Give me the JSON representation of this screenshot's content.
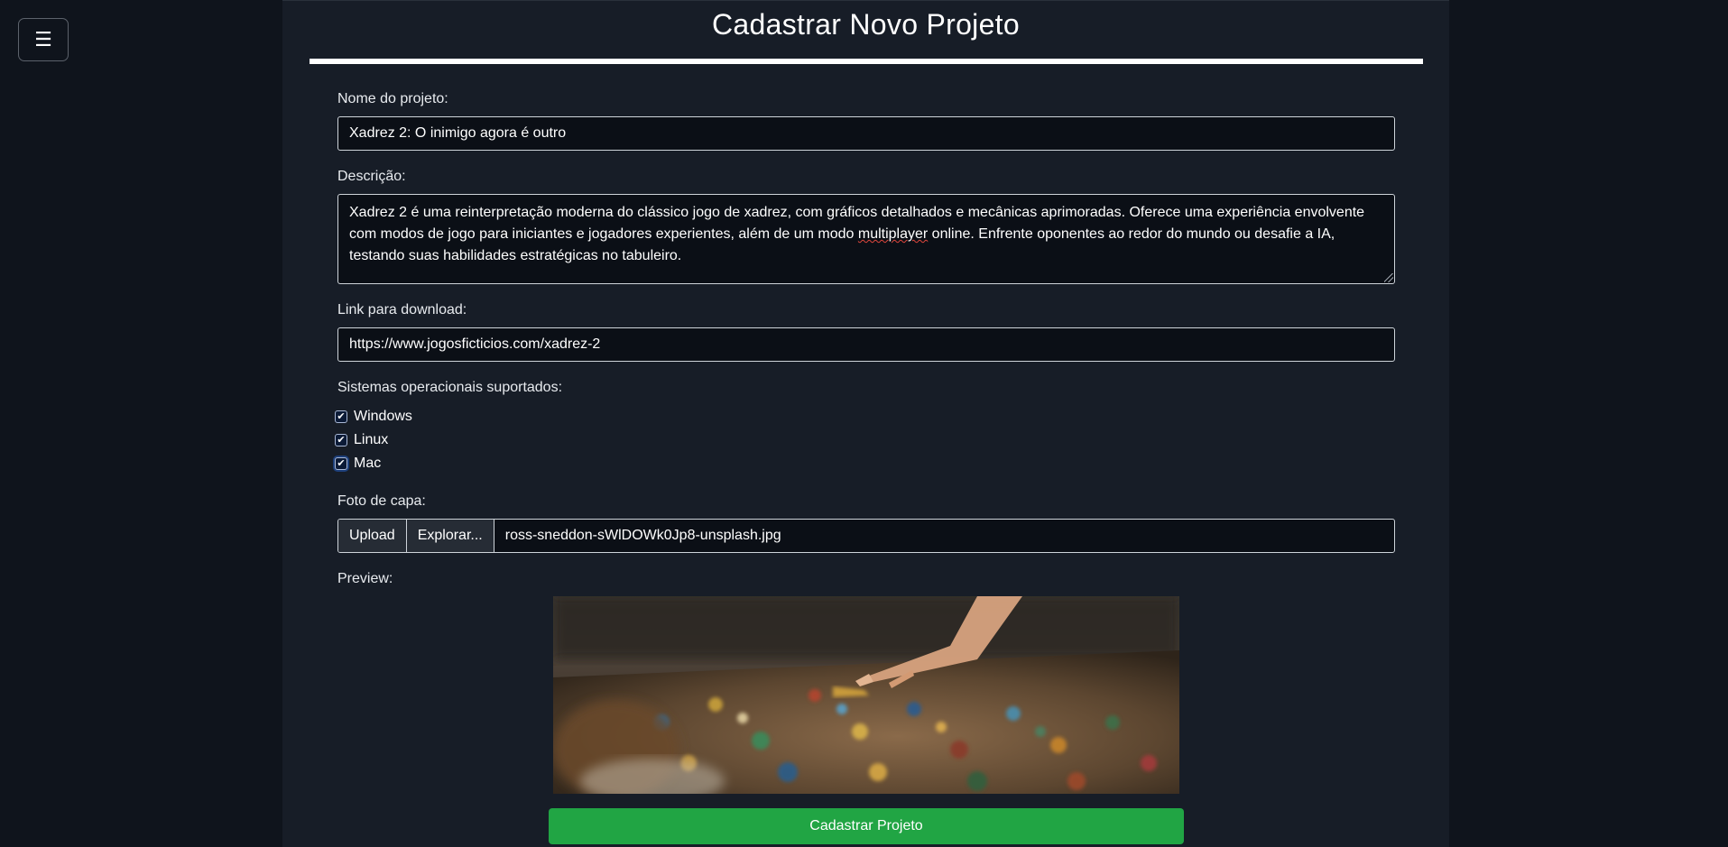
{
  "menu_button": {
    "label": "☰"
  },
  "page": {
    "title": "Cadastrar Novo Projeto"
  },
  "form": {
    "name": {
      "label": "Nome do projeto:",
      "value": "Xadrez 2: O inimigo agora é outro"
    },
    "description": {
      "label": "Descrição:",
      "value_before": "Xadrez 2 é uma reinterpretação moderna do clássico jogo de xadrez, com gráficos detalhados e mecânicas aprimoradas. Oferece uma experiência envolvente com modos de jogo para iniciantes e jogadores experientes, além de um modo ",
      "value_flagged": "multiplayer",
      "value_after": " online. Enfrente oponentes ao redor do mundo ou desafie a IA, testando suas habilidades estratégicas no tabuleiro."
    },
    "download": {
      "label": "Link para download:",
      "value": "https://www.jogosficticios.com/xadrez-2"
    },
    "os": {
      "label": "Sistemas operacionais suportados:",
      "options": [
        {
          "label": "Windows",
          "checked": true
        },
        {
          "label": "Linux",
          "checked": true
        },
        {
          "label": "Mac",
          "checked": true
        }
      ],
      "check_glyph": "✔"
    },
    "cover": {
      "label": "Foto de capa:",
      "upload_label": "Upload",
      "browse_label": "Explorar...",
      "file_name": "ross-sneddon-sWlDOWk0Jp8-unsplash.jpg"
    },
    "preview": {
      "label": "Preview:",
      "image_subject": "hand placing a piece on a colorful jigsaw puzzle on a table"
    },
    "submit_label": "Cadastrar Projeto"
  },
  "colors": {
    "page_background": "#0f141c",
    "panel_background": "#171d27",
    "submit_green": "#21a544",
    "input_border": "#ced4da"
  }
}
